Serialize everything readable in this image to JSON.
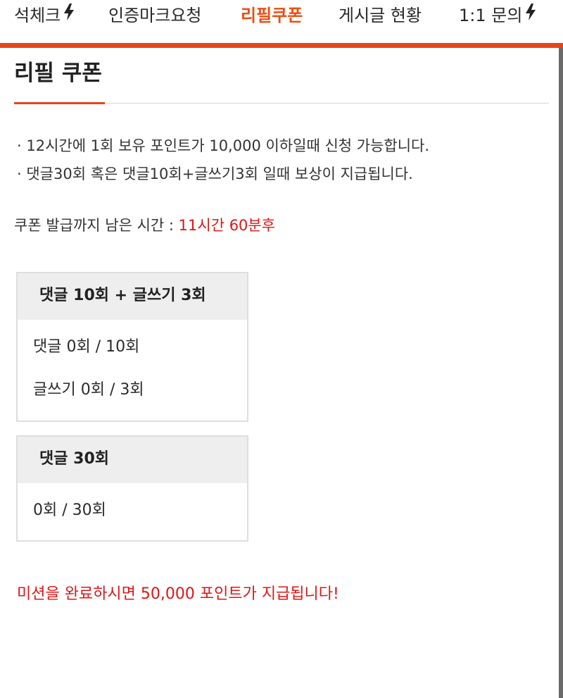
{
  "tabs": [
    {
      "label": "석체크",
      "active": false,
      "icon": "lightning-bolt-icon"
    },
    {
      "label": "인증마크요청",
      "active": false
    },
    {
      "label": "리필쿠폰",
      "active": true
    },
    {
      "label": "게시글 현황",
      "active": false
    },
    {
      "label": "1:1 문의",
      "active": false,
      "icon": "lightning-bolt-icon"
    }
  ],
  "page": {
    "title": "리필 쿠폰"
  },
  "rules": [
    "· 12시간에 1회 보유 포인트가 10,000 이하일때 신청 가능합니다.",
    "· 댓글30회 혹은 댓글10회+글쓰기3회 일때 보상이 지급됩니다."
  ],
  "timer": {
    "label": "쿠폰 발급까지 남은 시간 : ",
    "value": "11시간 60분후"
  },
  "missions": [
    {
      "title": "댓글 10회 + 글쓰기 3회",
      "rows": [
        "댓글 0회 / 10회",
        "글쓰기 0회 / 3회"
      ]
    },
    {
      "title": "댓글 30회",
      "rows": [
        "0회 / 30회"
      ]
    }
  ],
  "reward_note": "미션을 완료하시면 50,000 포인트가 지급됩니다!",
  "colors": {
    "accent": "#e8431a",
    "active_tab": "#ee4d12",
    "highlight_text": "#e01515",
    "box_header_bg": "#eeeeee",
    "box_border": "#dedede"
  }
}
